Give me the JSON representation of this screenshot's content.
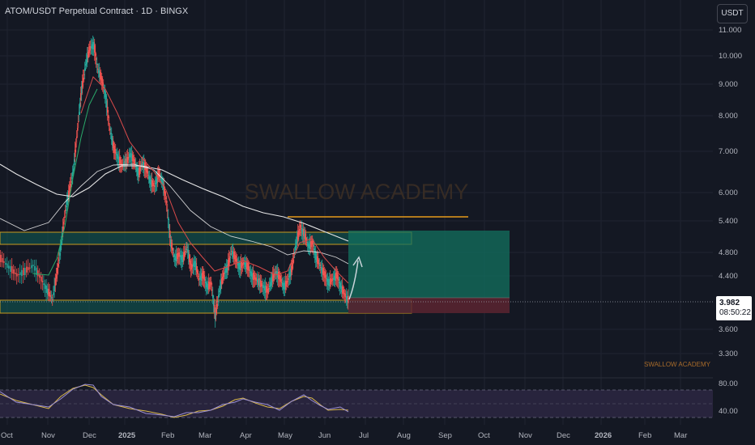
{
  "header": {
    "title": "ATOM/USDT Perpetual Contract · 1D · BINGX",
    "currency_button": "USDT"
  },
  "price_axis": {
    "ticks": [
      "11.000",
      "10.000",
      "9.000",
      "8.000",
      "7.000",
      "6.000",
      "5.400",
      "4.800",
      "4.400",
      "3.600",
      "3.300"
    ]
  },
  "rsi_axis": {
    "ticks": [
      "80.00",
      "40.00"
    ]
  },
  "time_axis": {
    "labels": [
      "Oct",
      "Nov",
      "Dec",
      "2025",
      "Feb",
      "Mar",
      "Apr",
      "May",
      "Jun",
      "Jul",
      "Aug",
      "Sep",
      "Oct",
      "Nov",
      "Dec",
      "2026",
      "Feb",
      "Mar"
    ]
  },
  "last_price": {
    "price": "3.982",
    "countdown": "08:50:22"
  },
  "watermark": "SWALLOW ACADEMY",
  "footer_watermark": "SWALLOW ACADEMY",
  "colors": {
    "background": "#141823",
    "bull": "#26a69a",
    "bear": "#ef5350",
    "ma_slow": "#e6e6e6",
    "ma_fast_red": "#d84a4a",
    "ma_fast_green": "#2aa96a",
    "zone_border": "#c99a1e",
    "resistance": "#e69a1a",
    "target_box": "#0f6b5c",
    "stop_box": "#5a2530",
    "rsi_line": "#d9b84a",
    "rsi_band": "#2a2640"
  }
}
